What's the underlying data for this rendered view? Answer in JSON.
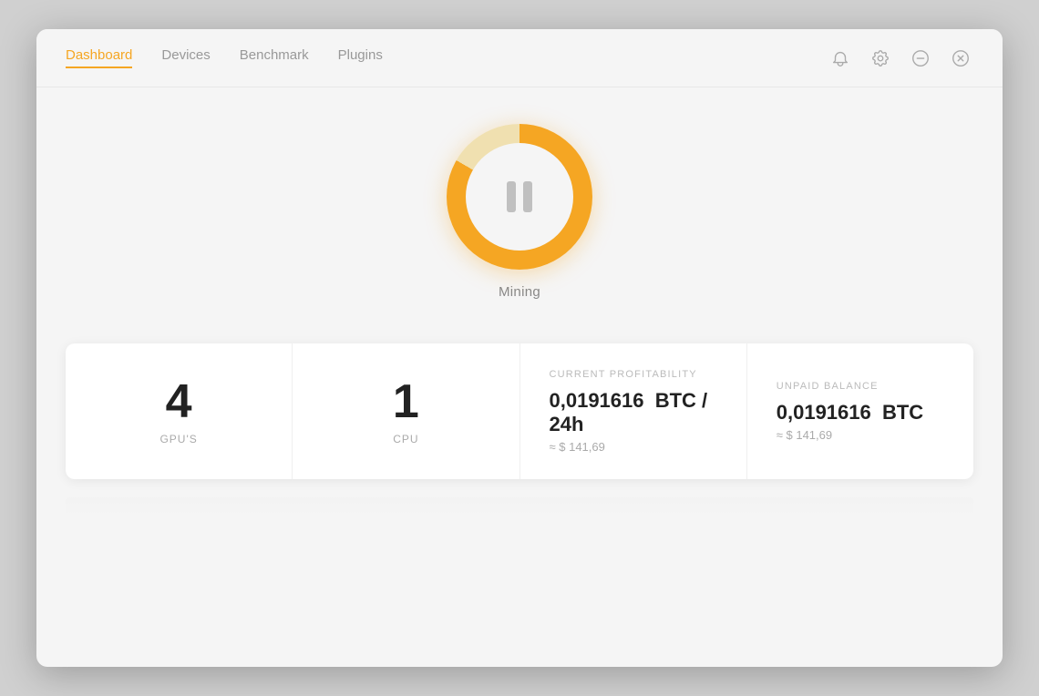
{
  "nav": {
    "items": [
      {
        "id": "dashboard",
        "label": "Dashboard",
        "active": true
      },
      {
        "id": "devices",
        "label": "Devices",
        "active": false
      },
      {
        "id": "benchmark",
        "label": "Benchmark",
        "active": false
      },
      {
        "id": "plugins",
        "label": "Plugins",
        "active": false
      }
    ]
  },
  "mining": {
    "status_label": "Mining",
    "button_state": "pause"
  },
  "stats": {
    "gpu_count": "4",
    "gpu_label": "GPU'S",
    "cpu_count": "1",
    "cpu_label": "CPU",
    "current_profitability": {
      "title": "CURRENT PROFITABILITY",
      "btc_value": "0,0191616",
      "btc_unit": "BTC / 24h",
      "usd_approx": "≈ $ 141,69"
    },
    "unpaid_balance": {
      "title": "UNPAID BALANCE",
      "btc_value": "0,0191616",
      "btc_unit": "BTC",
      "usd_approx": "≈ $ 141,69"
    }
  }
}
